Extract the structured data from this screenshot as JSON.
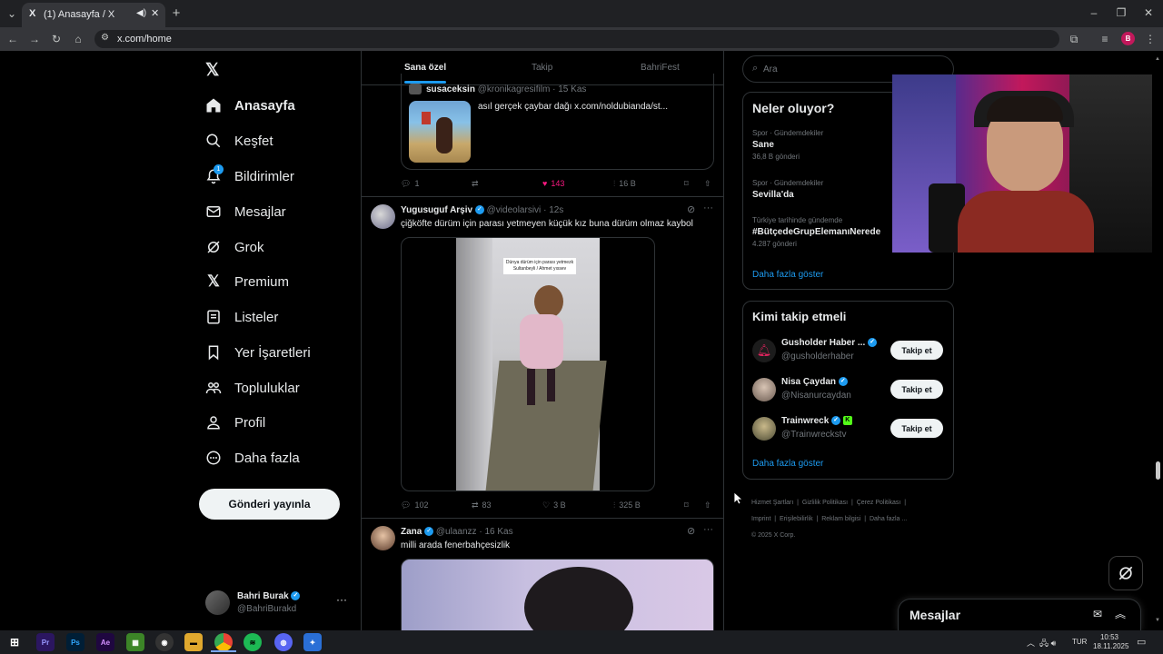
{
  "browser": {
    "tab_title": "(1) Anasayfa / X",
    "url": "x.com/home",
    "profile_initial": "B"
  },
  "nav": {
    "items": [
      {
        "label": "Anasayfa",
        "icon": "home-icon"
      },
      {
        "label": "Keşfet",
        "icon": "search-icon"
      },
      {
        "label": "Bildirimler",
        "icon": "bell-icon",
        "badge": "1"
      },
      {
        "label": "Mesajlar",
        "icon": "mail-icon"
      },
      {
        "label": "Grok",
        "icon": "grok-icon"
      },
      {
        "label": "Premium",
        "icon": "x-icon"
      },
      {
        "label": "Listeler",
        "icon": "list-icon"
      },
      {
        "label": "Yer İşaretleri",
        "icon": "bookmark-icon"
      },
      {
        "label": "Topluluklar",
        "icon": "community-icon"
      },
      {
        "label": "Profil",
        "icon": "profile-icon"
      },
      {
        "label": "Daha fazla",
        "icon": "more-circle-icon"
      }
    ],
    "post_button": "Gönderi yayınla",
    "account": {
      "name": "Bahri Burak",
      "handle": "@BahriBurakd"
    }
  },
  "timeline": {
    "tabs": [
      "Sana özel",
      "Takip",
      "BahriFest"
    ],
    "active_tab": 0,
    "quoted": {
      "name": "susaceksin",
      "handle": "@kronikagresifilm",
      "time": "15 Kas",
      "text": "asıl gerçek çaybar dağı  x.com/noldubianda/st..."
    },
    "post0_actions": {
      "replies": "1",
      "reposts": "",
      "likes": "143",
      "views": "16 B"
    },
    "post1": {
      "name": "Yugusuguf Arşiv",
      "handle": "@videolarsivi",
      "time": "12s",
      "text": "çiğköfte dürüm için parası yetmeyen küçük kız buna dürüm olmaz kaybol",
      "video_caption": "Dünya dürüm için parası yetmezk Sultanbeyli / Ahmet yıssev",
      "actions": {
        "replies": "102",
        "reposts": "83",
        "likes": "3 B",
        "views": "325 B"
      }
    },
    "post2": {
      "name": "Zana",
      "handle": "@ulaanzz",
      "time": "16 Kas",
      "text": "milli arada fenerbahçesizlik"
    }
  },
  "sidebar": {
    "search_placeholder": "Ara",
    "trends_title": "Neler oluyor?",
    "trends": [
      {
        "meta": "Spor · Gündemdekiler",
        "name": "Sane",
        "count": "36,8 B gönderi"
      },
      {
        "meta": "Spor · Gündemdekiler",
        "name": "Sevilla'da",
        "count": ""
      },
      {
        "meta": "Türkiye tarihinde gündemde",
        "name": "#BütçedeGrupElemanıNerede",
        "count": "4.287 gönderi"
      }
    ],
    "show_more": "Daha fazla göster",
    "follow_title": "Kimi takip etmeli",
    "follow": [
      {
        "name": "Gusholder Haber ...",
        "handle": "@gusholderhaber",
        "button": "Takip et"
      },
      {
        "name": "Nisa Çaydan",
        "handle": "@Nisanurcaydan",
        "button": "Takip et"
      },
      {
        "name": "Trainwreck",
        "handle": "@Trainwreckstv",
        "button": "Takip et"
      }
    ],
    "footer_links": [
      "Hizmet Şartları",
      "Gizlilik Politikası",
      "Çerez Politikası",
      "Imprint",
      "Erişilebilirlik",
      "Reklam bilgisi",
      "Daha fazla ..."
    ],
    "copyright": "© 2025 X Corp."
  },
  "messages_dock": {
    "title": "Mesajlar"
  },
  "taskbar": {
    "lang": "TUR",
    "time": "10:53",
    "date": "18.11.2025"
  },
  "colors": {
    "like": "#f91880",
    "link": "#1d9bf0",
    "verified": "#1d9bf0"
  }
}
